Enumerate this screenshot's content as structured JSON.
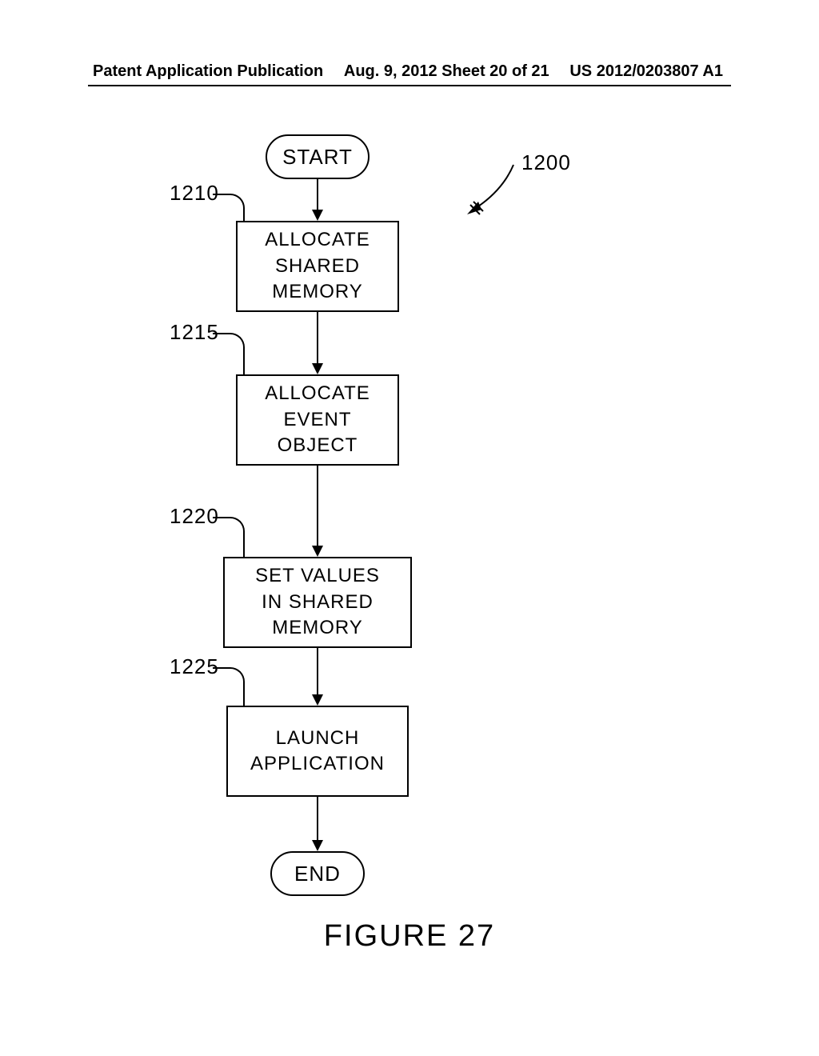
{
  "header": {
    "left": "Patent Application Publication",
    "center": "Aug. 9, 2012  Sheet 20 of 21",
    "right": "US 2012/0203807 A1"
  },
  "flowchart": {
    "ref_main": "1200",
    "start": "START",
    "end": "END",
    "steps": [
      {
        "ref": "1210",
        "text": "ALLOCATE\nSHARED\nMEMORY"
      },
      {
        "ref": "1215",
        "text": "ALLOCATE\nEVENT\nOBJECT"
      },
      {
        "ref": "1220",
        "text": "SET VALUES\nIN SHARED\nMEMORY"
      },
      {
        "ref": "1225",
        "text": "LAUNCH\nAPPLICATION"
      }
    ]
  },
  "figure_label": "FIGURE 27"
}
